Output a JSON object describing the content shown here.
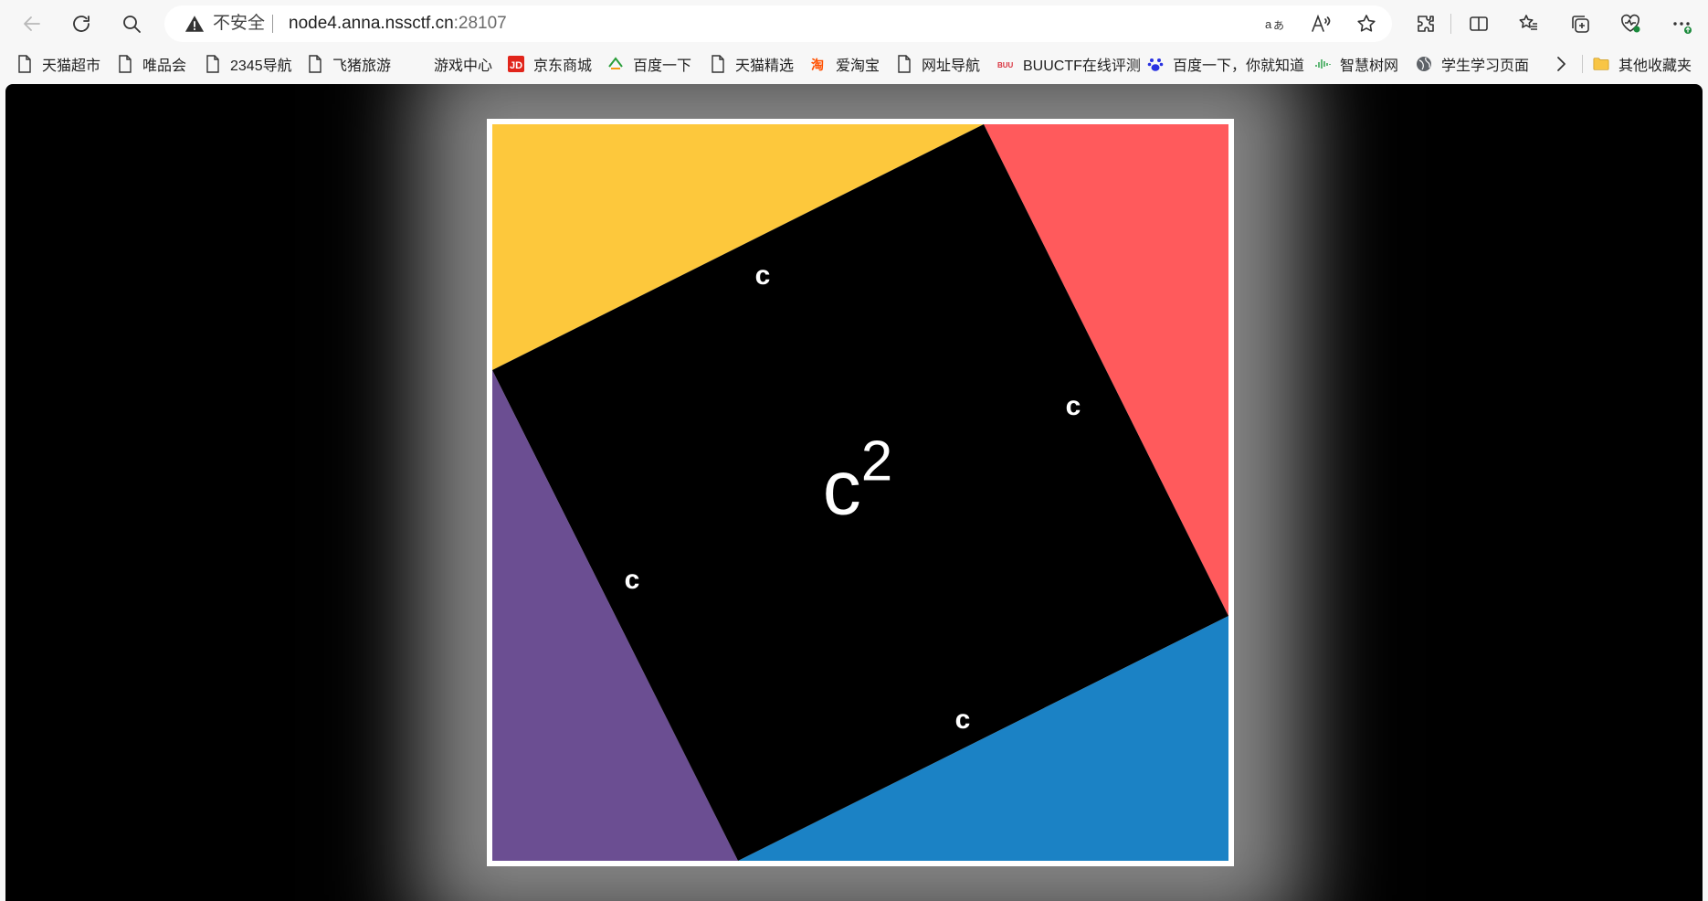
{
  "browser": {
    "security_label": "不安全",
    "url_host": "node4.anna.nssctf.cn",
    "url_port": ":28107",
    "icons": [
      "back-icon",
      "refresh-icon",
      "search-icon",
      "warning-icon",
      "translate-icon",
      "read-aloud-icon",
      "favorite-star-icon",
      "extensions-icon",
      "split-screen-icon",
      "favorites-icon",
      "collections-icon",
      "browser-essentials-icon",
      "more-icon"
    ]
  },
  "bookmarks": [
    {
      "label": "天猫超市",
      "icon": "page-icon"
    },
    {
      "label": "唯品会",
      "icon": "page-icon"
    },
    {
      "label": "2345导航",
      "icon": "page-icon"
    },
    {
      "label": "飞猪旅游",
      "icon": "page-icon"
    },
    {
      "label": "游戏中心",
      "icon": "none"
    },
    {
      "label": "京东商城",
      "icon": "jd-icon"
    },
    {
      "label": "百度一下",
      "icon": "2345-icon"
    },
    {
      "label": "天猫精选",
      "icon": "page-icon"
    },
    {
      "label": "爱淘宝",
      "icon": "taobao-icon"
    },
    {
      "label": "网址导航",
      "icon": "page-icon"
    },
    {
      "label": "BUUCTF在线评测",
      "icon": "buuctf-icon"
    },
    {
      "label": "百度一下，你就知道",
      "icon": "baidu-paw-icon"
    },
    {
      "label": "智慧树网",
      "icon": "zhihuishu-icon"
    },
    {
      "label": "学生学习页面",
      "icon": "globe-icon"
    },
    {
      "label": "其他收藏夹",
      "icon": "folder-icon"
    }
  ],
  "figure": {
    "colors": {
      "yellow": "#fdc83c",
      "red": "#ff5a5c",
      "blue": "#1b82c5",
      "purple": "#6b4e92",
      "square": "#000000"
    },
    "side_labels": [
      "c",
      "c",
      "c",
      "c"
    ],
    "center_label": "c",
    "center_exponent": "2"
  }
}
